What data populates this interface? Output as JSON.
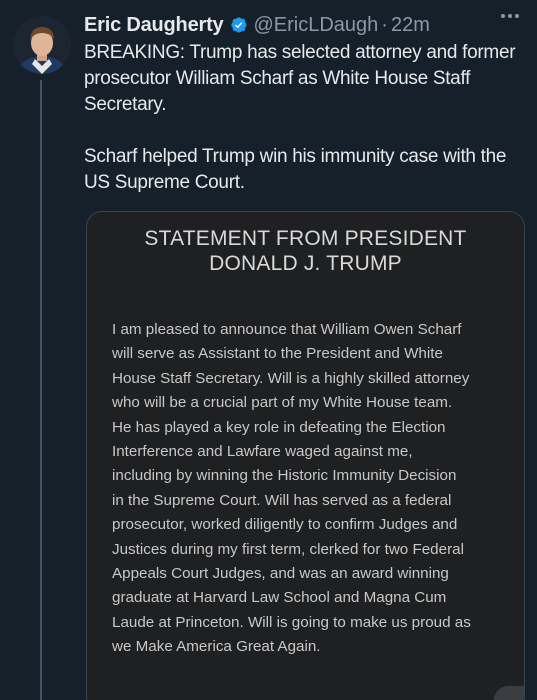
{
  "tweet": {
    "author": {
      "display_name": "Eric Daugherty",
      "handle": "@EricLDaugh",
      "verified": true
    },
    "separator": "·",
    "time": "22m",
    "text_paragraphs": [
      "BREAKING: Trump has selected attorney and former prosecutor William Scharf as White House Staff Secretary.",
      "Scharf helped Trump win his immunity case with the US Supreme Court."
    ],
    "media": {
      "title_lines": [
        "STATEMENT FROM PRESIDENT",
        "DONALD J. TRUMP"
      ],
      "body_lines": [
        "I am pleased to announce that William Owen Scharf",
        "will serve as Assistant to the President and White",
        "House Staff Secretary. Will is a highly skilled attorney",
        "who will be a crucial part of my White House team.",
        "He has played a key role in defeating the Election",
        "Interference and Lawfare waged against me,",
        "including by winning the Historic Immunity Decision",
        "in the Supreme Court. Will has served as a federal",
        "prosecutor, worked diligently to confirm Judges and",
        "Justices during my first term, clerked for two Federal",
        "Appeals Court Judges, and was an award winning",
        "graduate at Harvard Law School and Magna Cum",
        "Laude at Princeton. Will is going to make us proud as",
        "we Make America Great Again."
      ]
    }
  },
  "icons": {
    "verified": "verified-badge-icon",
    "more": "more-options-icon",
    "avatar": "profile-avatar"
  },
  "colors": {
    "background": "#15202b",
    "verified": "#1d9bf0",
    "text_primary": "#e7e9ea",
    "text_secondary": "#8b98a5"
  }
}
